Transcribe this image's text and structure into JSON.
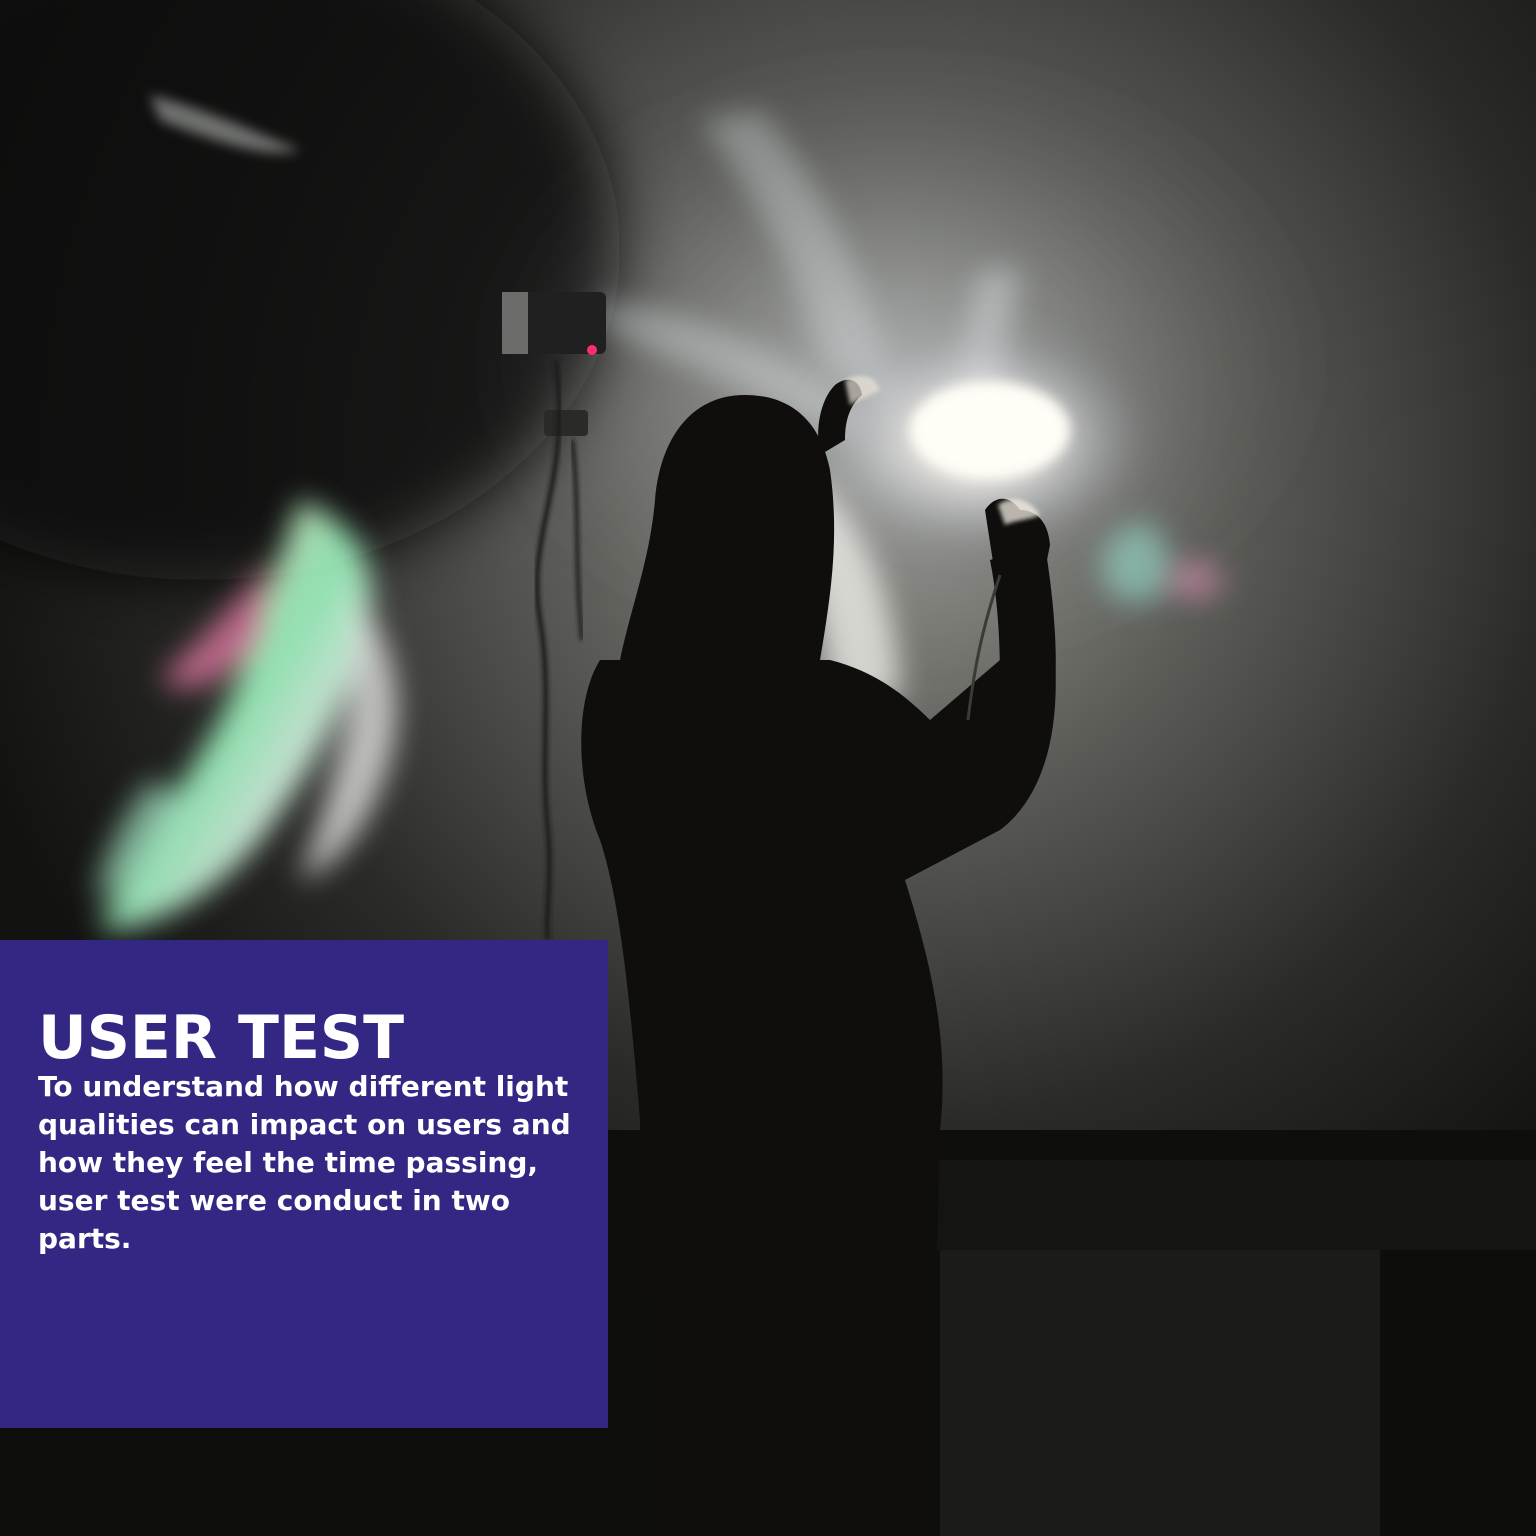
{
  "caption": {
    "title": "USER TEST",
    "body": "To understand how different light qualities can impact on users and how they feel the time passing, user test were conduct in two parts."
  },
  "colors": {
    "panel_background": "#322884",
    "caption_text": "#ffffff",
    "room_background": "#0b0b0a"
  }
}
